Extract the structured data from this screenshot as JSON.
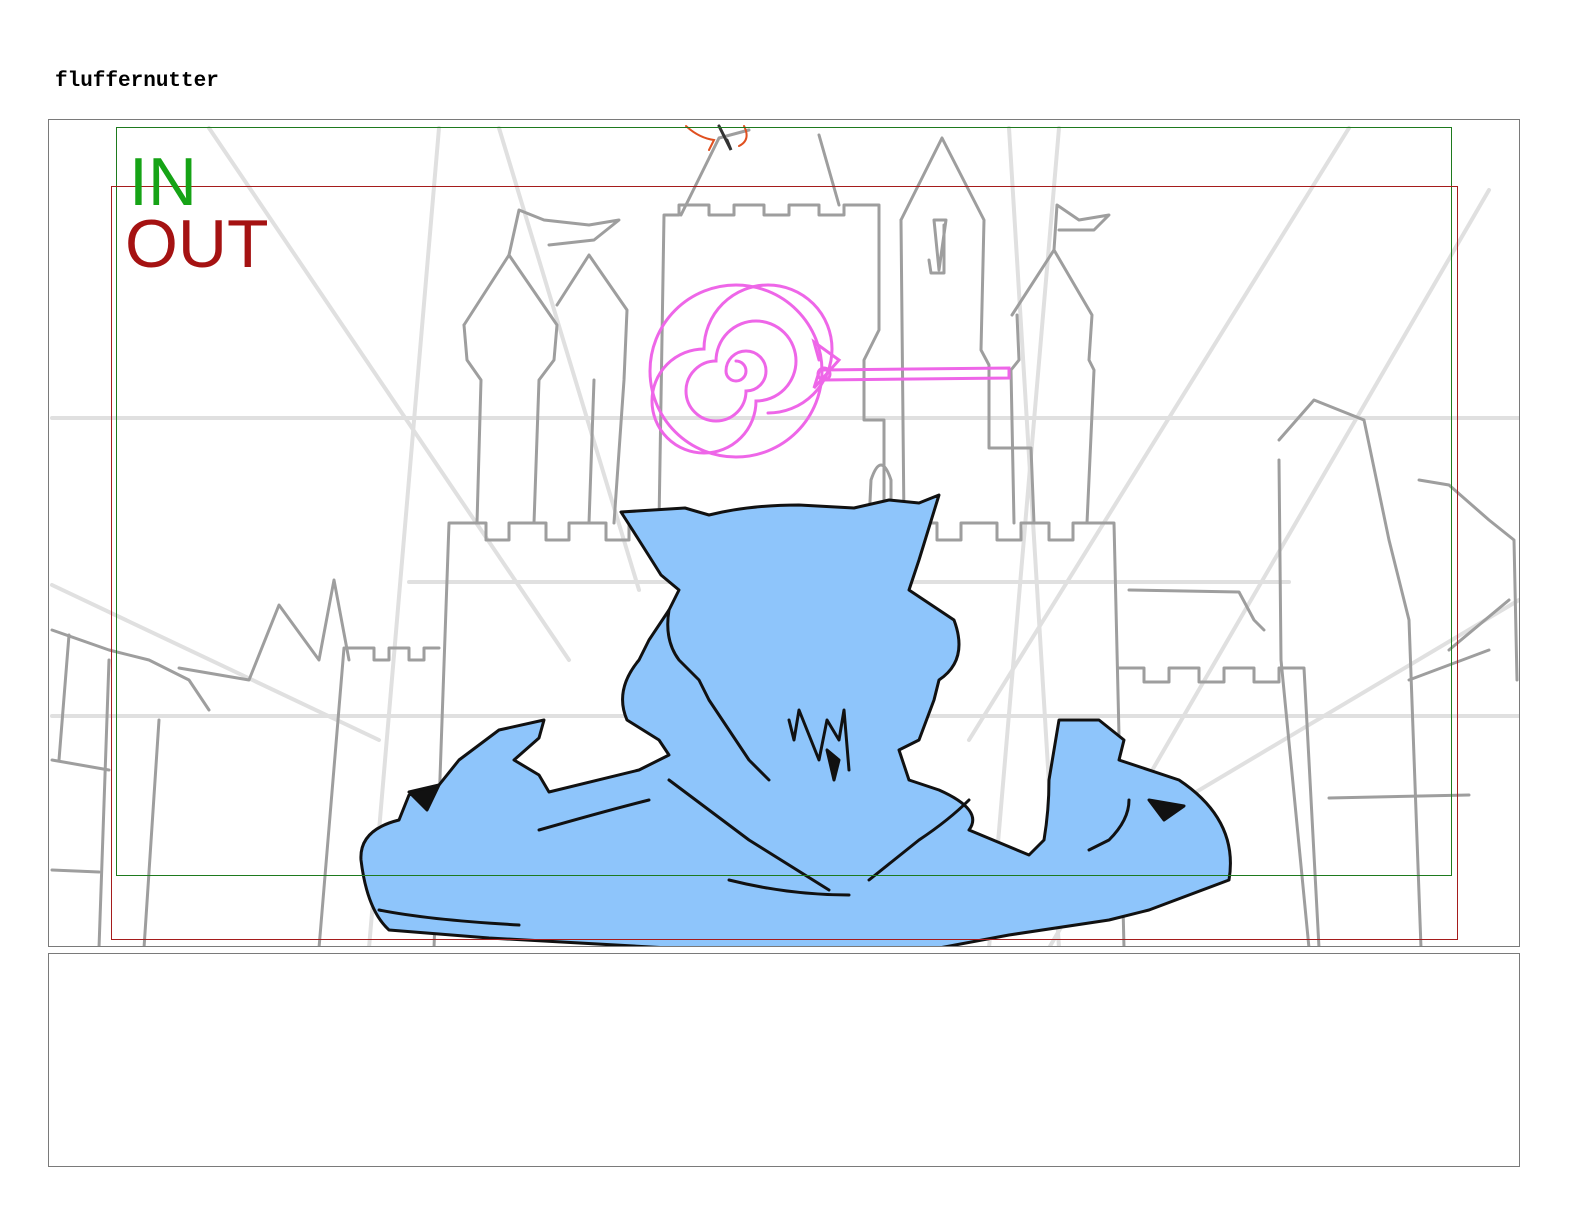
{
  "page": {
    "title": "fluffernutter"
  },
  "panel": {
    "in_label": "IN",
    "out_label": "OUT",
    "colors": {
      "in_frame": "#1e7a1e",
      "out_frame": "#a51c1c",
      "character_fill": "#8ec5fb",
      "lollipop": "#ee66e8",
      "castle_lines": "#9e9e9e",
      "guide_lines": "#dddddd"
    }
  },
  "notes": {
    "text": ""
  }
}
